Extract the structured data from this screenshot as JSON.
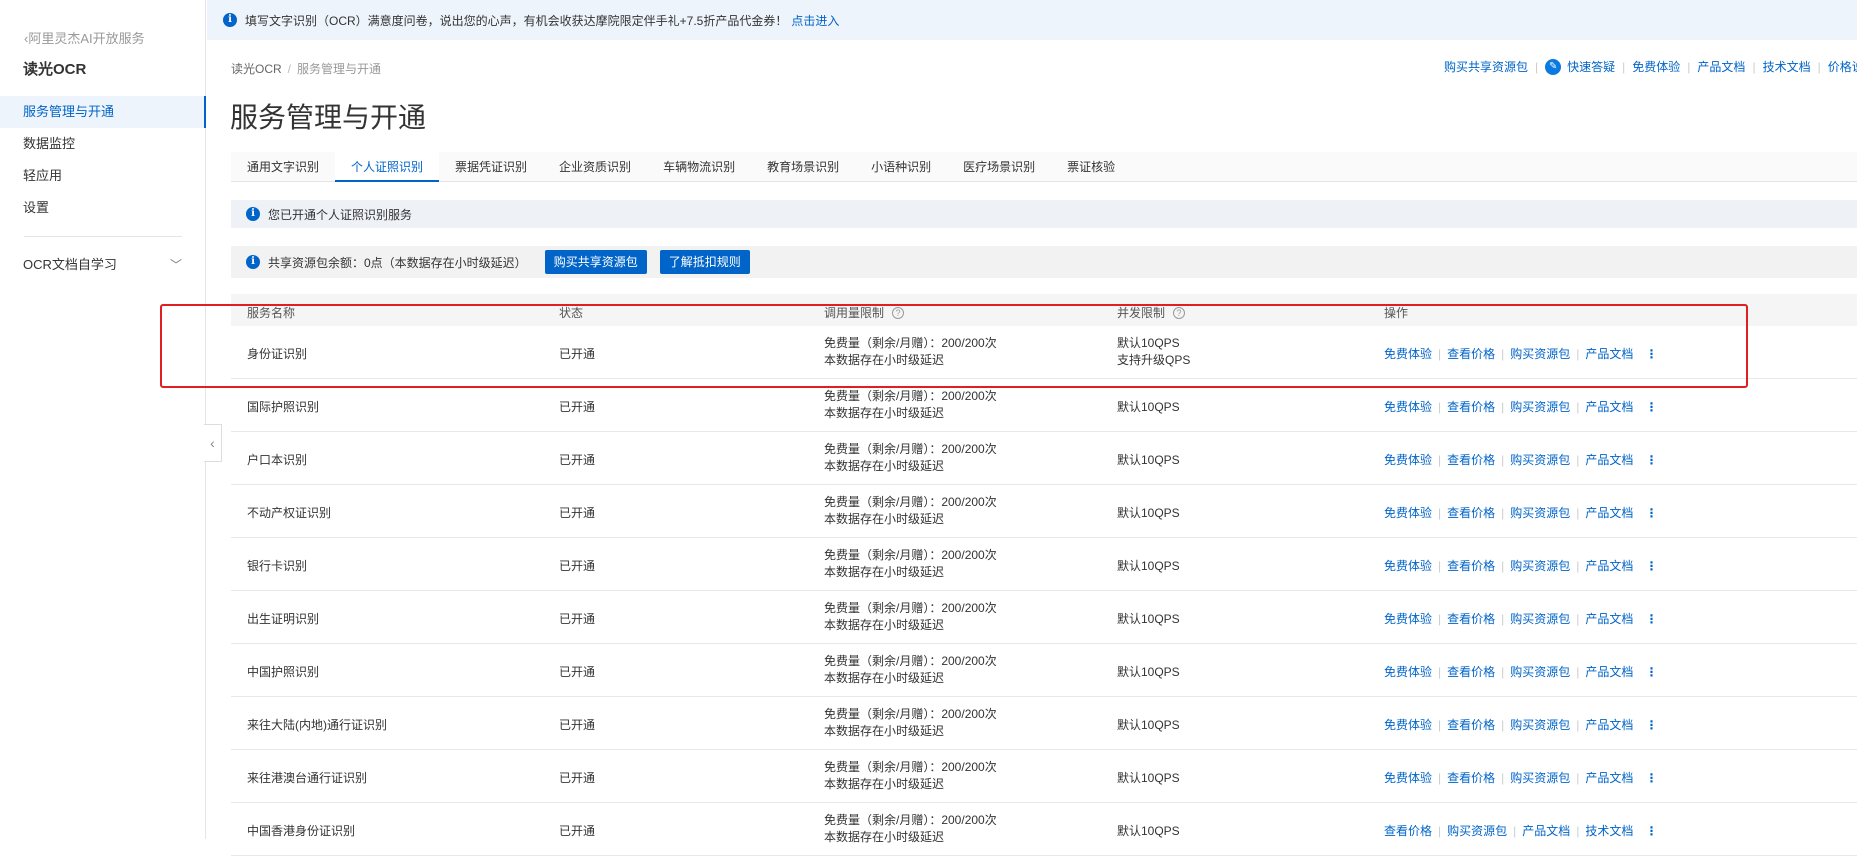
{
  "sidebar": {
    "back_label": "阿里灵杰AI开放服务",
    "product_title": "读光OCR",
    "items": [
      {
        "label": "服务管理与开通",
        "active": true
      },
      {
        "label": "数据监控"
      },
      {
        "label": "轻应用"
      },
      {
        "label": "设置"
      }
    ],
    "group_label": "OCR文档自学习"
  },
  "banner": {
    "text": "填写文字识别（OCR）满意度问卷，说出您的心声，有机会收获达摩院限定伴手礼+7.5折产品代金券！",
    "link": "点击进入"
  },
  "breadcrumb": [
    "读光OCR",
    "服务管理与开通"
  ],
  "top_links": [
    "购买共享资源包",
    "快速答疑",
    "免费体验",
    "产品文档",
    "技术文档",
    "价格说"
  ],
  "page_title": "服务管理与开通",
  "tabs": [
    "通用文字识别",
    "个人证照识别",
    "票据凭证识别",
    "企业资质识别",
    "车辆物流识别",
    "教育场景识别",
    "小语种识别",
    "医疗场景识别",
    "票证核验"
  ],
  "notice_text": "您已开通个人证照识别服务",
  "quota": {
    "text": "共享资源包余额：0点（本数据存在小时级延迟）",
    "buy_button": "购买共享资源包",
    "rules_button": "了解抵扣规则"
  },
  "table": {
    "headers": [
      "服务名称",
      "状态",
      "调用量限制",
      "并发限制",
      "操作"
    ],
    "rows": [
      {
        "name": "身份证识别",
        "status": "已开通",
        "quota1": "免费量（剩余/月赠）：200/200次",
        "quota2": "本数据存在小时级延迟",
        "conc1": "默认10QPS",
        "conc2": "支持升级QPS",
        "ops": [
          "免费体验",
          "查看价格",
          "购买资源包",
          "产品文档"
        ]
      },
      {
        "name": "国际护照识别",
        "status": "已开通",
        "quota1": "免费量（剩余/月赠）：200/200次",
        "quota2": "本数据存在小时级延迟",
        "conc1": "默认10QPS",
        "ops": [
          "免费体验",
          "查看价格",
          "购买资源包",
          "产品文档"
        ]
      },
      {
        "name": "户口本识别",
        "status": "已开通",
        "quota1": "免费量（剩余/月赠）：200/200次",
        "quota2": "本数据存在小时级延迟",
        "conc1": "默认10QPS",
        "ops": [
          "免费体验",
          "查看价格",
          "购买资源包",
          "产品文档"
        ]
      },
      {
        "name": "不动产权证识别",
        "status": "已开通",
        "quota1": "免费量（剩余/月赠）：200/200次",
        "quota2": "本数据存在小时级延迟",
        "conc1": "默认10QPS",
        "ops": [
          "免费体验",
          "查看价格",
          "购买资源包",
          "产品文档"
        ]
      },
      {
        "name": "银行卡识别",
        "status": "已开通",
        "quota1": "免费量（剩余/月赠）：200/200次",
        "quota2": "本数据存在小时级延迟",
        "conc1": "默认10QPS",
        "ops": [
          "免费体验",
          "查看价格",
          "购买资源包",
          "产品文档"
        ]
      },
      {
        "name": "出生证明识别",
        "status": "已开通",
        "quota1": "免费量（剩余/月赠）：200/200次",
        "quota2": "本数据存在小时级延迟",
        "conc1": "默认10QPS",
        "ops": [
          "免费体验",
          "查看价格",
          "购买资源包",
          "产品文档"
        ]
      },
      {
        "name": "中国护照识别",
        "status": "已开通",
        "quota1": "免费量（剩余/月赠）：200/200次",
        "quota2": "本数据存在小时级延迟",
        "conc1": "默认10QPS",
        "ops": [
          "免费体验",
          "查看价格",
          "购买资源包",
          "产品文档"
        ]
      },
      {
        "name": "来往大陆(内地)通行证识别",
        "status": "已开通",
        "quota1": "免费量（剩余/月赠）：200/200次",
        "quota2": "本数据存在小时级延迟",
        "conc1": "默认10QPS",
        "ops": [
          "免费体验",
          "查看价格",
          "购买资源包",
          "产品文档"
        ]
      },
      {
        "name": "来往港澳台通行证识别",
        "status": "已开通",
        "quota1": "免费量（剩余/月赠）：200/200次",
        "quota2": "本数据存在小时级延迟",
        "conc1": "默认10QPS",
        "ops": [
          "免费体验",
          "查看价格",
          "购买资源包",
          "产品文档"
        ]
      },
      {
        "name": "中国香港身份证识别",
        "status": "已开通",
        "quota1": "免费量（剩余/月赠）：200/200次",
        "quota2": "本数据存在小时级延迟",
        "conc1": "默认10QPS",
        "ops": [
          "查看价格",
          "购买资源包",
          "产品文档",
          "技术文档"
        ]
      }
    ]
  },
  "colors": {
    "accent": "#0064c8",
    "highlight": "#e02020",
    "banner_bg": "#eef4fb"
  }
}
